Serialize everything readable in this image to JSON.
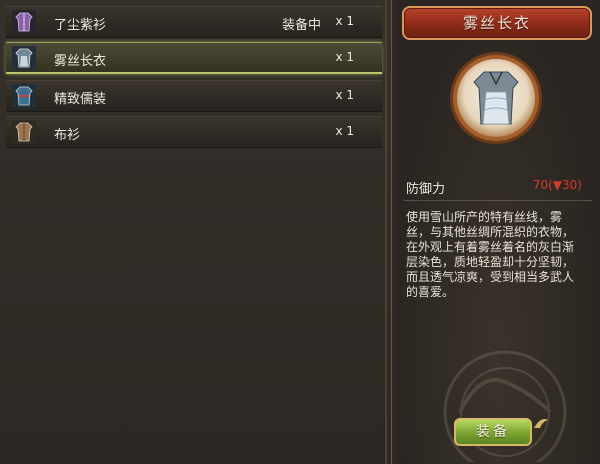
{
  "inventory": {
    "items": [
      {
        "name": "了尘紫衫",
        "status": "装备中",
        "quantity": "x 1",
        "icon": "purple-robe-icon",
        "selected": false
      },
      {
        "name": "雾丝长衣",
        "status": "",
        "quantity": "x 1",
        "icon": "blue-robe-icon",
        "selected": true
      },
      {
        "name": "精致儒装",
        "status": "",
        "quantity": "x 1",
        "icon": "teal-robe-icon",
        "selected": false
      },
      {
        "name": "布衫",
        "status": "",
        "quantity": "x 1",
        "icon": "brown-robe-icon",
        "selected": false
      }
    ]
  },
  "detail": {
    "title": "雾丝长衣",
    "portrait_icon": "mist-robe-portrait-icon",
    "stat_label": "防御力",
    "stat_value": "70(▼30)",
    "description": "使用雪山所产的特有丝线，雾丝，与其他丝绸所混织的衣物，在外观上有着雾丝着名的灰白渐层染色，质地轻盈却十分坚韧，而且透气凉爽，受到相当多武人的喜爱。",
    "equip_label": "装备"
  },
  "colors": {
    "selected_highlight": "#b8c86a",
    "stat_value": "#d63a2a",
    "title_plate": "#8e2a19",
    "equip_button": "#7fa733"
  }
}
